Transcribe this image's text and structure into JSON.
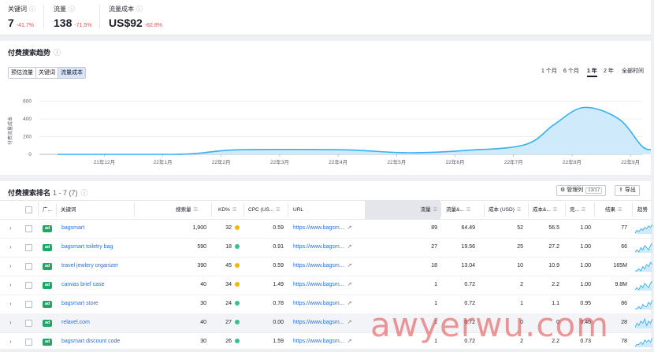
{
  "kpis": [
    {
      "label": "关键词",
      "value": "7",
      "delta": "-41.7%"
    },
    {
      "label": "流量",
      "value": "138",
      "delta": "-71.5%"
    },
    {
      "label": "流量成本",
      "value": "US$92",
      "delta": "-82.8%"
    }
  ],
  "info_glyph": "ⓘ",
  "trend": {
    "title": "付费搜索趋势",
    "tabs": [
      "预估流量",
      "关键词",
      "流量成本"
    ],
    "active_tab": 2,
    "periods": [
      "1 个月",
      "6 个月",
      "1 年",
      "2 年",
      "全部时间"
    ],
    "active_period": 2
  },
  "chart_data": {
    "type": "area",
    "ylabel": "付费流量成本",
    "yticks": [
      0,
      200,
      400,
      600
    ],
    "ylim": [
      0,
      650
    ],
    "x_labels": [
      "21年12月",
      "22年1月",
      "22年2月",
      "22年3月",
      "22年4月",
      "22年5月",
      "22年6月",
      "22年7月",
      "22年8月",
      "22年9月",
      "22年10月"
    ],
    "points": [
      {
        "t": 0,
        "v": 0
      },
      {
        "t": 1,
        "v": 0
      },
      {
        "t": 2,
        "v": 0
      },
      {
        "t": 2.4,
        "v": 12
      },
      {
        "t": 3,
        "v": 50
      },
      {
        "t": 4,
        "v": 55
      },
      {
        "t": 5,
        "v": 50
      },
      {
        "t": 6,
        "v": 18
      },
      {
        "t": 7,
        "v": 45
      },
      {
        "t": 8,
        "v": 110
      },
      {
        "t": 8.5,
        "v": 340
      },
      {
        "t": 9,
        "v": 530
      },
      {
        "t": 9.6,
        "v": 400
      },
      {
        "t": 10,
        "v": 90
      },
      {
        "t": 10.2,
        "v": 55
      }
    ],
    "color": "#35b0f0",
    "fill": "#cfeafb"
  },
  "table": {
    "title": "付费搜索排名",
    "range": "1 - 7 (7)",
    "manage_label": "管理列",
    "manage_count": "13/17",
    "export_label": "导出",
    "columns": {
      "ad": "广...",
      "keyword": "关键词",
      "volume": "搜索量",
      "kd": "KD%",
      "cpc": "CPC (US...",
      "url": "URL",
      "traffic": "流量",
      "traffic_pct": "流量&...",
      "cost": "成本 (USD)",
      "cost_pct": "成本&...",
      "comp": "竞...",
      "results": "结果",
      "trend": "趋势"
    },
    "ad_badge": "ad",
    "chevron": "›",
    "ext_glyph": "↗",
    "sort_glyph": "☰",
    "rows": [
      {
        "keyword": "bagsmart",
        "volume": "1,900",
        "kd": "32",
        "kd_color": "#f2b705",
        "cpc": "0.59",
        "url": "https://www.bagsm...",
        "traffic": "89",
        "traffic_pct": "64.49",
        "cost": "52",
        "cost_pct": "56.5",
        "comp": "1.00",
        "results": "77",
        "spark": [
          4,
          6,
          5,
          7,
          6,
          8,
          7,
          9,
          8,
          10
        ]
      },
      {
        "keyword": "bagsmart toiletry bag",
        "volume": "590",
        "kd": "18",
        "kd_color": "#35c28a",
        "cpc": "0.91",
        "url": "https://www.bagsm...",
        "traffic": "27",
        "traffic_pct": "19.56",
        "cost": "25",
        "cost_pct": "27.2",
        "comp": "1.00",
        "results": "66",
        "spark": [
          3,
          4,
          3,
          5,
          4,
          6,
          5,
          4,
          6,
          7
        ]
      },
      {
        "keyword": "travel jewlery organizer",
        "volume": "390",
        "kd": "45",
        "kd_color": "#f2b705",
        "cpc": "0.59",
        "url": "https://www.bagsm...",
        "traffic": "18",
        "traffic_pct": "13.04",
        "cost": "10",
        "cost_pct": "10.9",
        "comp": "1.00",
        "results": "165M",
        "spark": [
          5,
          5,
          6,
          5,
          7,
          6,
          8,
          7,
          9,
          8
        ]
      },
      {
        "keyword": "canvas brief case",
        "volume": "40",
        "kd": "34",
        "kd_color": "#f2b705",
        "cpc": "1.49",
        "url": "https://www.bagsm...",
        "traffic": "1",
        "traffic_pct": "0.72",
        "cost": "2",
        "cost_pct": "2.2",
        "comp": "1.00",
        "results": "9.8M",
        "spark": [
          2,
          3,
          2,
          4,
          3,
          5,
          4,
          3,
          5,
          6
        ]
      },
      {
        "keyword": "bagsmart store",
        "volume": "30",
        "kd": "24",
        "kd_color": "#35c28a",
        "cpc": "0.78",
        "url": "https://www.bagsm...",
        "traffic": "1",
        "traffic_pct": "0.72",
        "cost": "1",
        "cost_pct": "1.1",
        "comp": "0.95",
        "results": "86",
        "spark": [
          3,
          3,
          4,
          3,
          5,
          4,
          4,
          6,
          5,
          7
        ]
      },
      {
        "keyword": "relavel.com",
        "volume": "40",
        "kd": "27",
        "kd_color": "#35c28a",
        "cpc": "0.00",
        "url": "https://www.bagsm...",
        "traffic": "1",
        "traffic_pct": "0.72",
        "cost": "0",
        "cost_pct": "0",
        "comp": "0.46",
        "results": "28",
        "spark": [
          2,
          4,
          3,
          5,
          4,
          6,
          3,
          5,
          4,
          6
        ]
      },
      {
        "keyword": "bagsmart discount code",
        "volume": "30",
        "kd": "26",
        "kd_color": "#35c28a",
        "cpc": "1.59",
        "url": "https://www.bagsm...",
        "traffic": "1",
        "traffic_pct": "0.72",
        "cost": "2",
        "cost_pct": "2.2",
        "comp": "0.73",
        "results": "78",
        "spark": [
          3,
          4,
          4,
          5,
          4,
          6,
          5,
          6,
          5,
          7
        ]
      }
    ]
  },
  "watermark": "awyerwu.com"
}
